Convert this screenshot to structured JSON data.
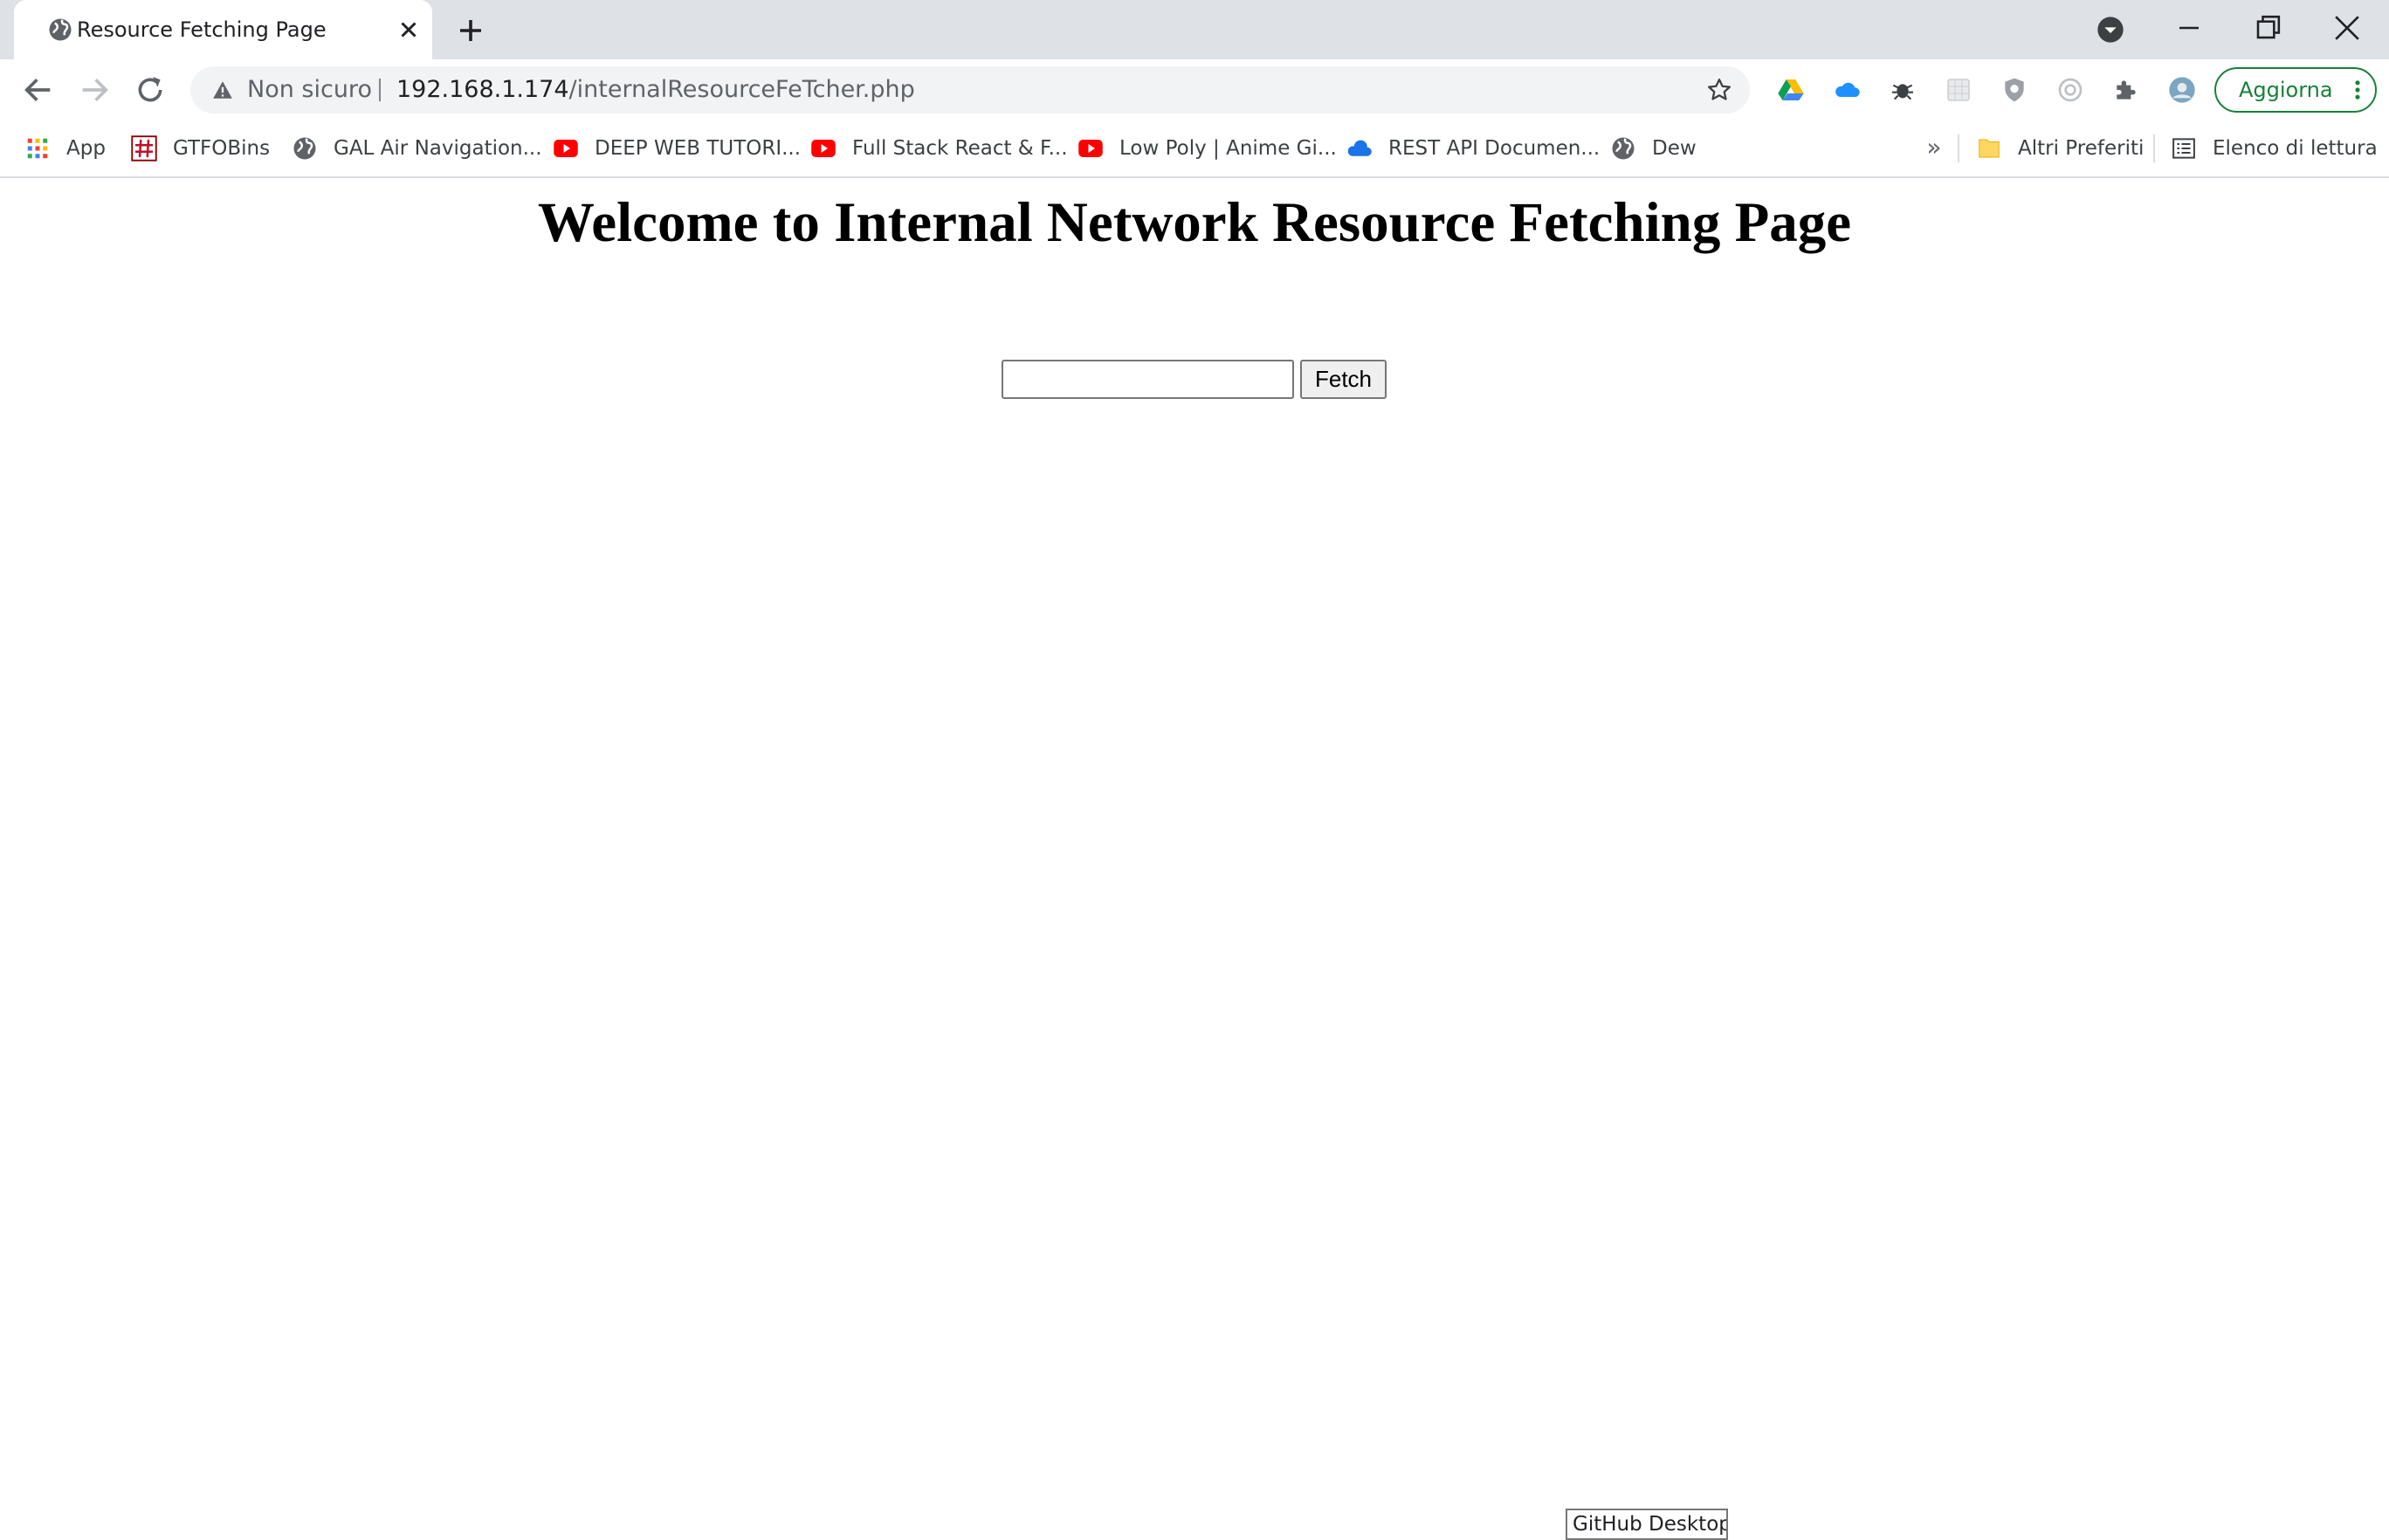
{
  "browser": {
    "tab": {
      "title": "Resource Fetching Page",
      "favicon": "globe-icon",
      "close_icon": "close-icon"
    },
    "new_tab_icon": "plus-icon",
    "window_controls": [
      "minimize-icon",
      "restore-icon",
      "close-icon"
    ],
    "profile_dropdown_icon": "chevron-down-circle-icon"
  },
  "toolbar": {
    "back_icon": "arrow-left-icon",
    "forward_icon": "arrow-right-icon",
    "reload_icon": "reload-icon",
    "security_label": "Non sicuro",
    "url_host": "192.168.1.174",
    "url_path": "/internalResourceFeTcher.php",
    "bookmark_star_icon": "star-outline-icon",
    "extensions": [
      "google-drive-icon",
      "onedrive-cloud-icon",
      "bug-extension-icon",
      "grid-extension-icon",
      "shield-extension-icon",
      "circle-extension-icon",
      "puzzle-icon",
      "profile-avatar-icon"
    ],
    "update_label": "Aggiorna"
  },
  "bookmarks": {
    "items": [
      {
        "label": "App",
        "icon": "apps-grid-icon"
      },
      {
        "label": "GTFOBins",
        "icon": "hash-icon"
      },
      {
        "label": "GAL Air Navigation...",
        "icon": "globe-icon"
      },
      {
        "label": "DEEP WEB TUTORI...",
        "icon": "youtube-icon"
      },
      {
        "label": "Full Stack React & F...",
        "icon": "youtube-icon"
      },
      {
        "label": "Low Poly | Anime Gi...",
        "icon": "youtube-icon"
      },
      {
        "label": "REST API Documen...",
        "icon": "cloud-icon"
      },
      {
        "label": "Dew",
        "icon": "globe-icon"
      }
    ],
    "overflow": "»",
    "other_bookmarks": {
      "label": "Altri Preferiti",
      "icon": "folder-icon"
    },
    "reading_list": {
      "label": "Elenco di lettura",
      "icon": "reading-list-icon"
    }
  },
  "page": {
    "heading": "Welcome to Internal Network Resource Fetching Page",
    "input_value": "",
    "fetch_button_label": "Fetch"
  },
  "tooltip": {
    "text": "GitHub Desktop"
  },
  "colors": {
    "tabstrip": "#dee1e6",
    "omnibox": "#f1f3f4",
    "update_accent": "#188038",
    "youtube_red": "#ff0000"
  }
}
